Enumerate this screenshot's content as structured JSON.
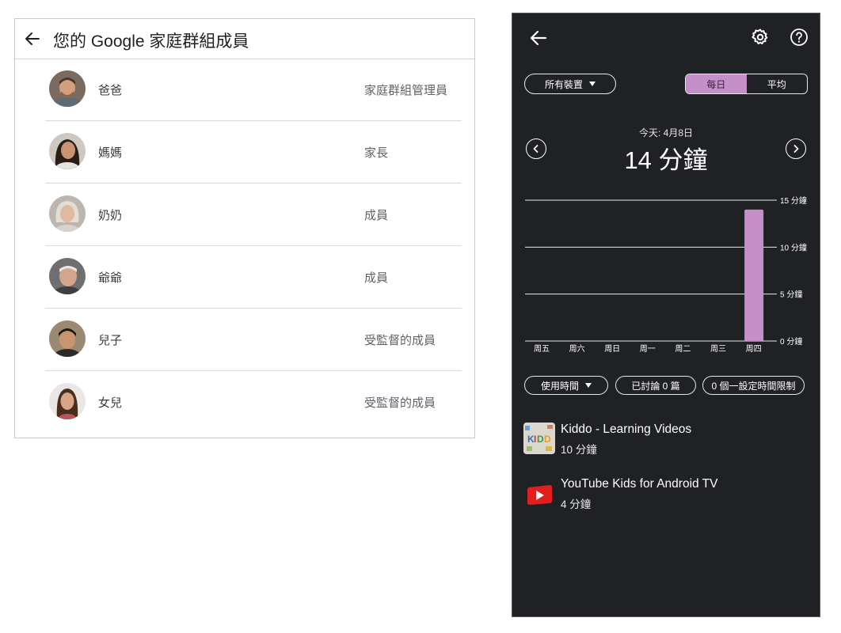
{
  "family": {
    "title": "您的 Google 家庭群組成員",
    "members": [
      {
        "name": "爸爸",
        "role": "家庭群組管理員"
      },
      {
        "name": "媽媽",
        "role": "家長"
      },
      {
        "name": "奶奶",
        "role": "成員"
      },
      {
        "name": "爺爺",
        "role": "成員"
      },
      {
        "name": "兒子",
        "role": "受監督的成員"
      },
      {
        "name": "女兒",
        "role": "受監督的成員"
      }
    ]
  },
  "usage": {
    "device_filter": "所有裝置",
    "tabs": {
      "daily": "每日",
      "average": "平均",
      "active": "daily"
    },
    "today_label": "今天: 4月8日",
    "total_time": "14 分鐘",
    "filters": {
      "usage_time": "使用時間",
      "discussed": "已討論 0 篇",
      "limits": "0 個一設定時間限制"
    },
    "apps": [
      {
        "name": "Kiddo - Learning Videos",
        "time": "10 分鐘",
        "icon": "kiddo-app-icon"
      },
      {
        "name": "YouTube Kids for Android TV",
        "time": "4 分鐘",
        "icon": "youtube-kids-icon"
      }
    ],
    "accent_color": "#c590c9"
  },
  "chart_data": {
    "type": "bar",
    "categories": [
      "周五",
      "周六",
      "周日",
      "周一",
      "周二",
      "周三",
      "周四"
    ],
    "values": [
      0,
      0,
      0,
      0,
      0,
      0,
      14
    ],
    "ylim": [
      0,
      15
    ],
    "y_ticks": [
      0,
      5,
      10,
      15
    ],
    "y_tick_labels": [
      "0 分鐘",
      "5 分鐘",
      "10 分鐘",
      "15 分鐘"
    ],
    "bar_color": "#c590c9",
    "grid": true
  }
}
